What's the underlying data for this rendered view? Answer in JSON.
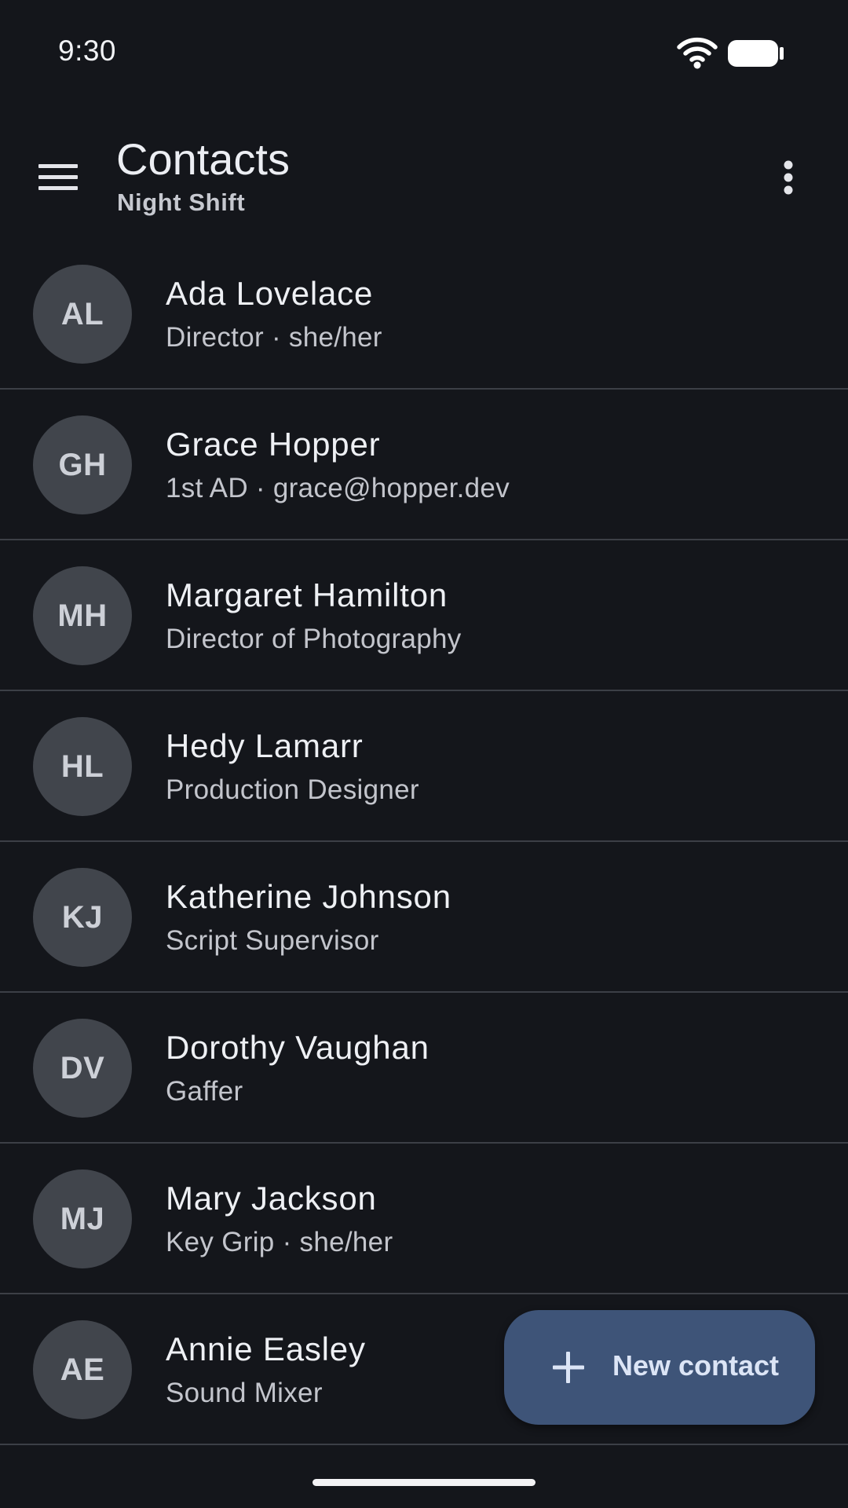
{
  "status_bar": {
    "time": "9:30",
    "icons": [
      "wifi-icon",
      "battery-icon"
    ]
  },
  "app_bar": {
    "title": "Contacts",
    "subtitle": "Night Shift",
    "leading_icon": "menu-icon",
    "trailing_icon": "more-vert-icon"
  },
  "contacts": [
    {
      "initials": "AL",
      "name": "Ada Lovelace",
      "detail": "Director · she/her"
    },
    {
      "initials": "GH",
      "name": "Grace Hopper",
      "detail": "1st AD · grace@hopper.dev"
    },
    {
      "initials": "MH",
      "name": "Margaret Hamilton",
      "detail": "Director of Photography"
    },
    {
      "initials": "HL",
      "name": "Hedy Lamarr",
      "detail": "Production Designer"
    },
    {
      "initials": "KJ",
      "name": "Katherine Johnson",
      "detail": "Script Supervisor"
    },
    {
      "initials": "DV",
      "name": "Dorothy Vaughan",
      "detail": "Gaffer"
    },
    {
      "initials": "MJ",
      "name": "Mary Jackson",
      "detail": "Key Grip · she/her"
    },
    {
      "initials": "AE",
      "name": "Annie Easley",
      "detail": "Sound Mixer"
    }
  ],
  "fab": {
    "icon": "plus-icon",
    "label": "New contact"
  },
  "colors": {
    "background": "#14161b",
    "avatar": "#41454c",
    "divider": "#3c3f46",
    "fab": "#3e5478"
  }
}
